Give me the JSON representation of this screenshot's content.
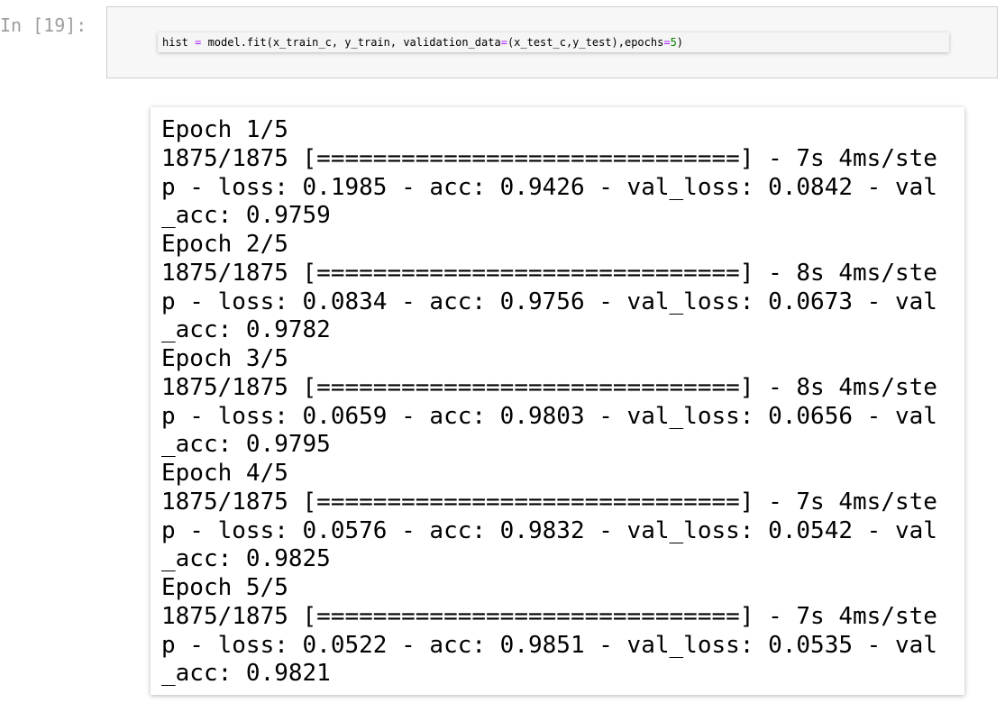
{
  "cell": {
    "prompt": "In [19]:",
    "code": {
      "part1": "hist ",
      "op1": "=",
      "part2": " model.fit(x_train_c, y_train, validation_data",
      "op2": "=",
      "part3": "(x_test_c,y_test),epochs",
      "op3": "=",
      "num1": "5",
      "part4": ")"
    }
  },
  "output": {
    "lines": [
      "Epoch 1/5",
      "1875/1875 [==============================] - 7s 4ms/ste",
      "p - loss: 0.1985 - acc: 0.9426 - val_loss: 0.0842 - val",
      "_acc: 0.9759",
      "Epoch 2/5",
      "1875/1875 [==============================] - 8s 4ms/ste",
      "p - loss: 0.0834 - acc: 0.9756 - val_loss: 0.0673 - val",
      "_acc: 0.9782",
      "Epoch 3/5",
      "1875/1875 [==============================] - 8s 4ms/ste",
      "p - loss: 0.0659 - acc: 0.9803 - val_loss: 0.0656 - val",
      "_acc: 0.9795",
      "Epoch 4/5",
      "1875/1875 [==============================] - 7s 4ms/ste",
      "p - loss: 0.0576 - acc: 0.9832 - val_loss: 0.0542 - val",
      "_acc: 0.9825",
      "Epoch 5/5",
      "1875/1875 [==============================] - 7s 4ms/ste",
      "p - loss: 0.0522 - acc: 0.9851 - val_loss: 0.0535 - val",
      "_acc: 0.9821"
    ]
  }
}
